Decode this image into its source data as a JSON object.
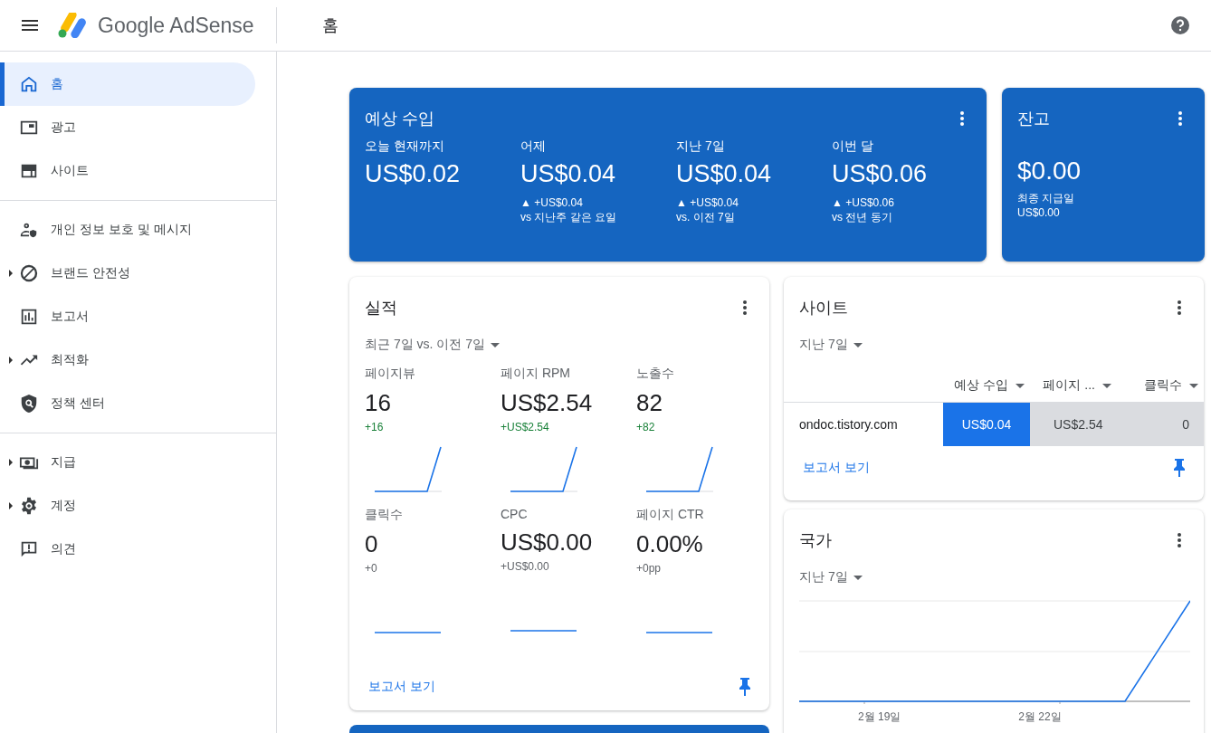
{
  "header": {
    "product": "Google AdSense",
    "page_title": "홈"
  },
  "sidebar": {
    "groups": [
      [
        {
          "label": "홈",
          "selected": true,
          "expandable": false
        },
        {
          "label": "광고",
          "selected": false,
          "expandable": false
        },
        {
          "label": "사이트",
          "selected": false,
          "expandable": false
        }
      ],
      [
        {
          "label": "개인 정보 보호 및 메시지",
          "selected": false,
          "expandable": false
        },
        {
          "label": "브랜드 안전성",
          "selected": false,
          "expandable": true
        },
        {
          "label": "보고서",
          "selected": false,
          "expandable": false
        },
        {
          "label": "최적화",
          "selected": false,
          "expandable": true
        },
        {
          "label": "정책 센터",
          "selected": false,
          "expandable": false
        }
      ],
      [
        {
          "label": "지급",
          "selected": false,
          "expandable": true
        },
        {
          "label": "계정",
          "selected": false,
          "expandable": true
        },
        {
          "label": "의견",
          "selected": false,
          "expandable": false
        }
      ]
    ]
  },
  "earnings": {
    "title": "예상 수입",
    "periods": [
      {
        "label": "오늘 현재까지",
        "value": "US$0.02"
      },
      {
        "label": "어제",
        "value": "US$0.04",
        "change": "▲ +US$0.04",
        "comparison": "vs 지난주 같은 요일"
      },
      {
        "label": "지난 7일",
        "value": "US$0.04",
        "change": "▲ +US$0.04",
        "comparison": "vs. 이전 7일"
      },
      {
        "label": "이번 달",
        "value": "US$0.06",
        "change": "▲ +US$0.06",
        "comparison": "vs 전년 동기"
      }
    ]
  },
  "balance": {
    "title": "잔고",
    "value": "$0.00",
    "last_payment_label": "최종 지급일",
    "last_payment_value": "US$0.00"
  },
  "performance": {
    "title": "실적",
    "range": "최근 7일 vs. 이전 7일",
    "metrics": [
      {
        "label": "페이지뷰",
        "value": "16",
        "change": "+16",
        "positive": true,
        "kind": "rising"
      },
      {
        "label": "페이지 RPM",
        "value": "US$2.54",
        "change": "+US$2.54",
        "positive": true,
        "kind": "rising"
      },
      {
        "label": "노출수",
        "value": "82",
        "change": "+82",
        "positive": true,
        "kind": "rising"
      },
      {
        "label": "클릭수",
        "value": "0",
        "change": "+0",
        "positive": false,
        "kind": "flat"
      },
      {
        "label": "CPC",
        "value": "US$0.00",
        "change": "+US$0.00",
        "positive": false,
        "kind": "flat"
      },
      {
        "label": "페이지 CTR",
        "value": "0.00%",
        "change": "+0pp",
        "positive": false,
        "kind": "flat"
      }
    ],
    "link": "보고서 보기"
  },
  "sites": {
    "title": "사이트",
    "range": "지난 7일",
    "columns": [
      {
        "label": "예상 수입",
        "selected": true
      },
      {
        "label": "페이지 ...",
        "selected": false
      },
      {
        "label": "클릭수",
        "selected": false
      }
    ],
    "rows": [
      {
        "site": "ondoc.tistory.com",
        "cells": [
          "US$0.04",
          "US$2.54",
          "0"
        ]
      }
    ],
    "link": "보고서 보기"
  },
  "countries": {
    "title": "국가",
    "range": "지난 7일",
    "x_labels": [
      "2월 19일",
      "2월 22일"
    ]
  }
}
